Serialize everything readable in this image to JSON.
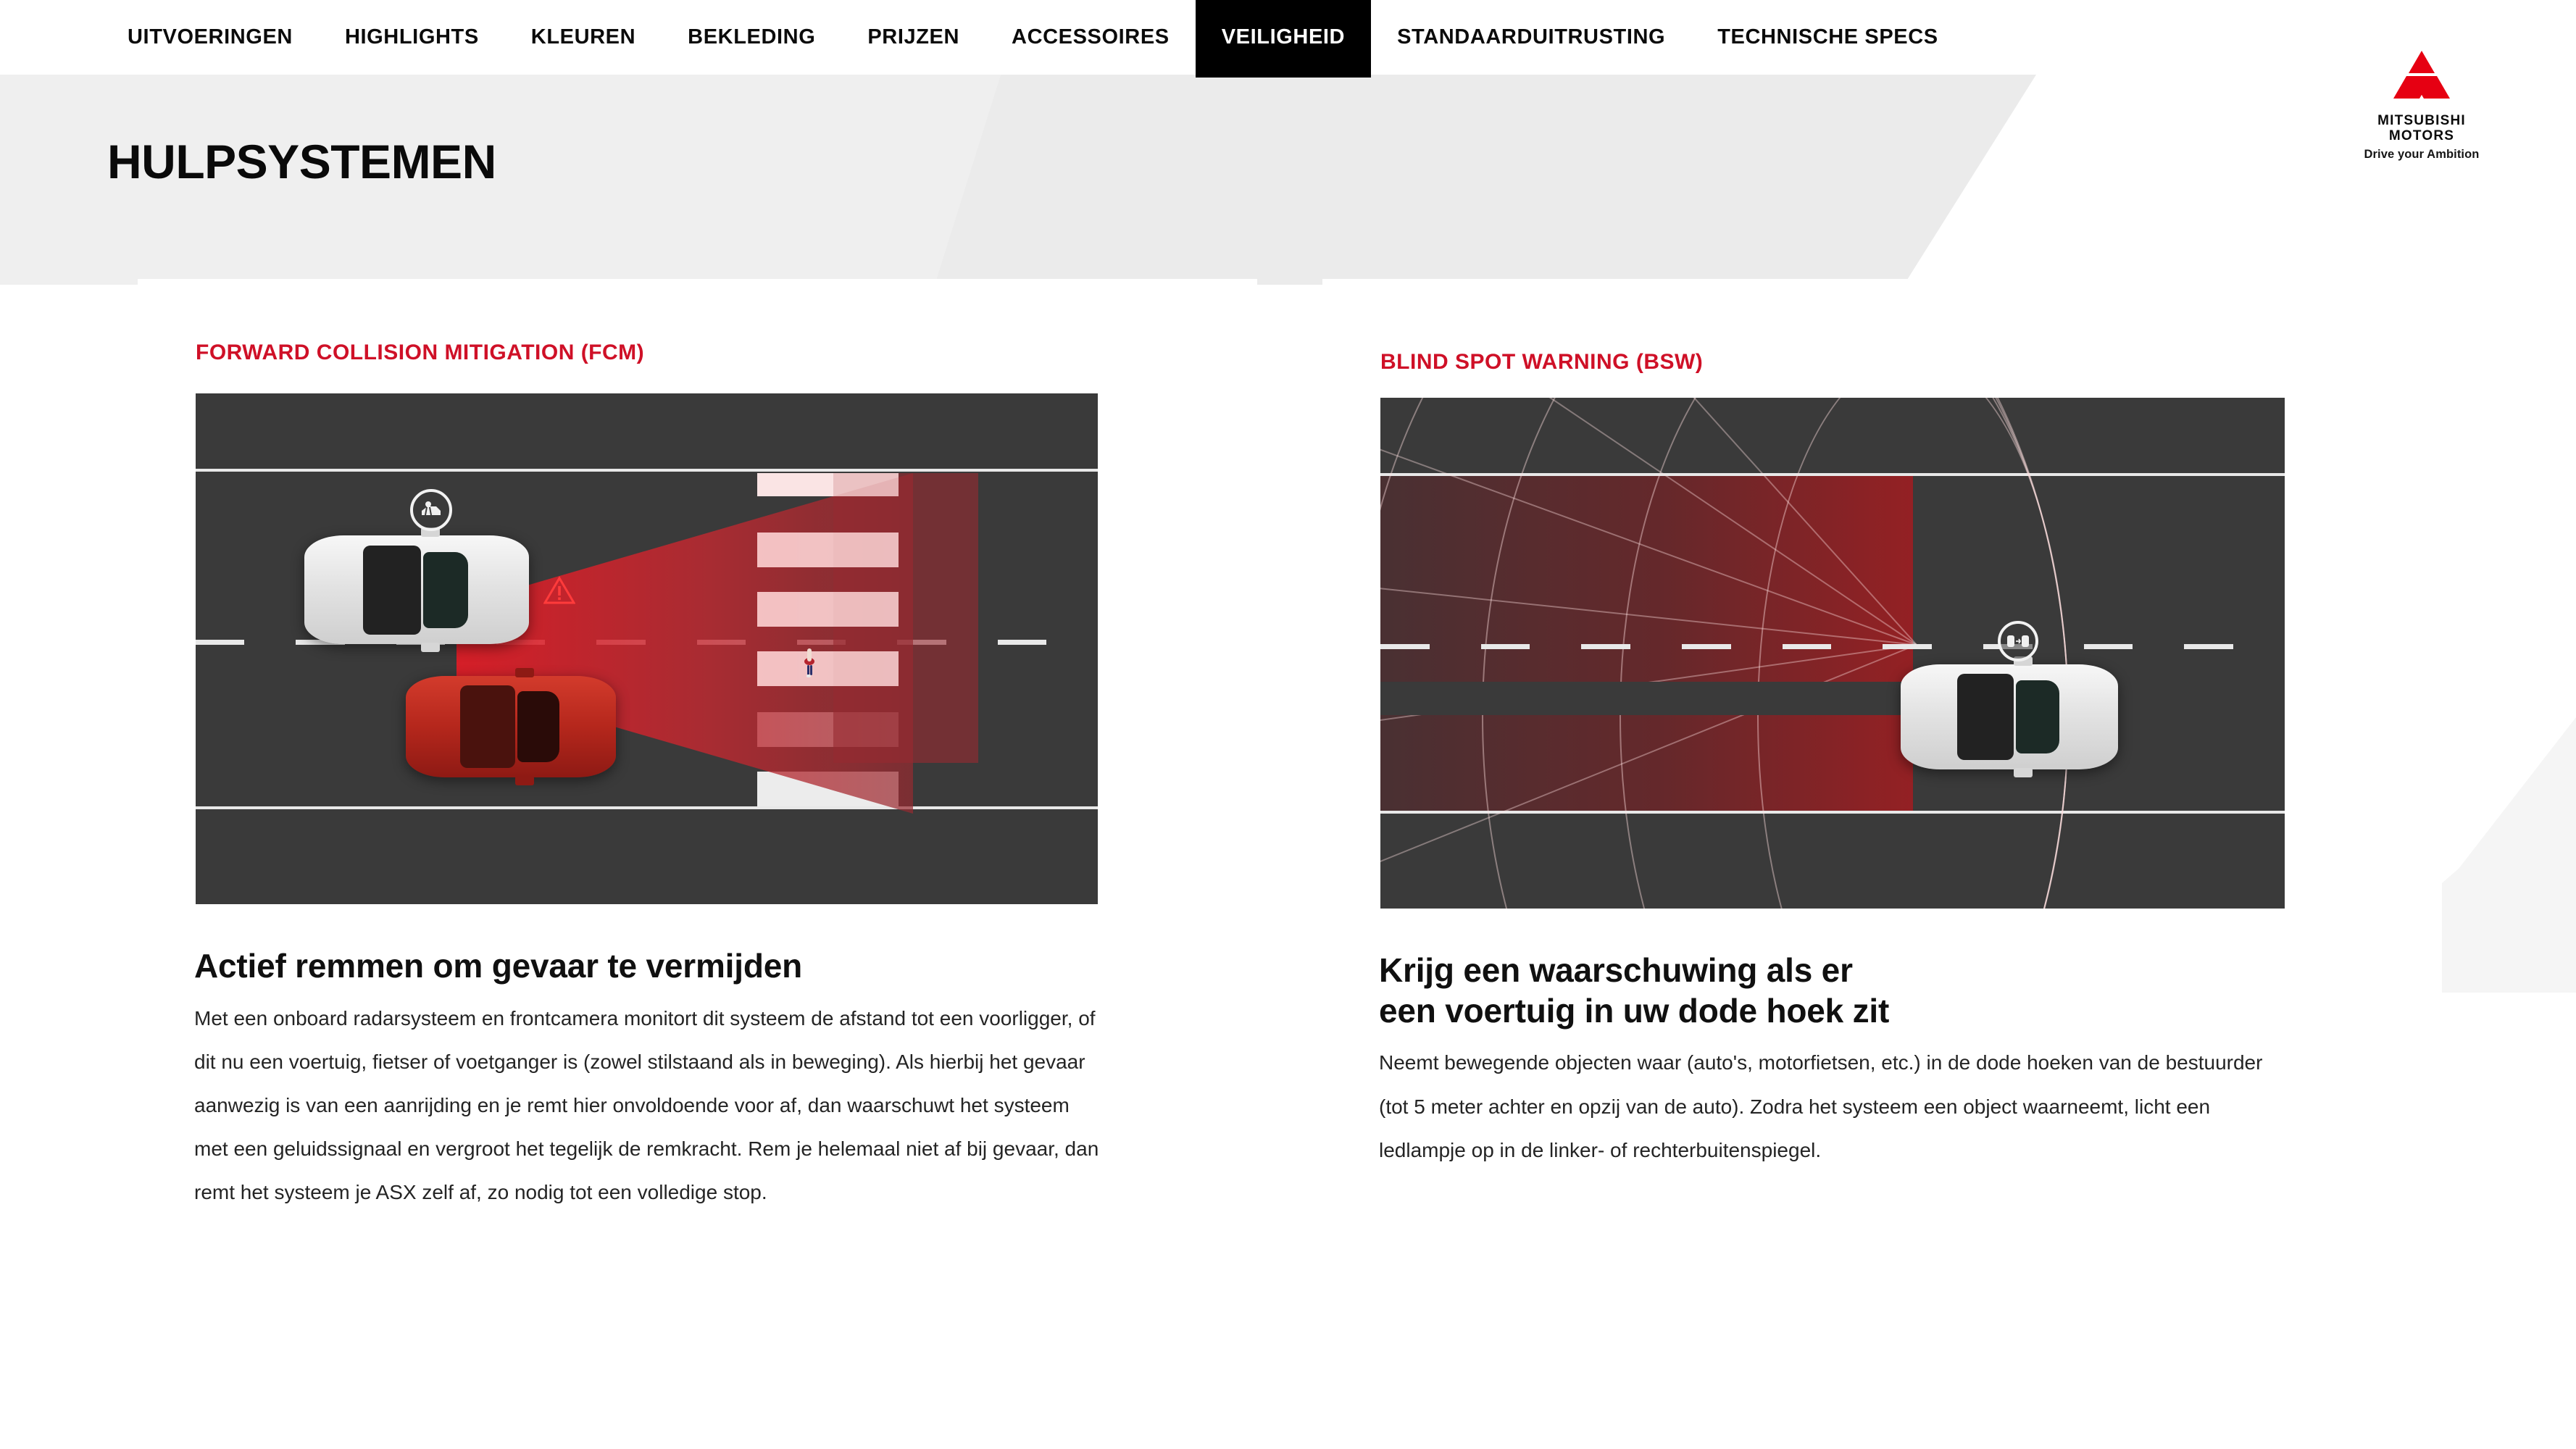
{
  "nav": {
    "items": [
      {
        "label": "UITVOERINGEN",
        "active": false
      },
      {
        "label": "HIGHLIGHTS",
        "active": false
      },
      {
        "label": "KLEUREN",
        "active": false
      },
      {
        "label": "BEKLEDING",
        "active": false
      },
      {
        "label": "PRIJZEN",
        "active": false
      },
      {
        "label": "ACCESSOIRES",
        "active": false
      },
      {
        "label": "VEILIGHEID",
        "active": true
      },
      {
        "label": "STANDAARDUITRUSTING",
        "active": false
      },
      {
        "label": "TECHNISCHE SPECS",
        "active": false
      }
    ]
  },
  "brand": {
    "name_line1": "MITSUBISHI",
    "name_line2": "MOTORS",
    "tagline": "Drive your Ambition",
    "logo_color": "#E60012"
  },
  "page": {
    "title": "HULPSYSTEMEN",
    "accent_color": "#CF1027",
    "background_color": "#FFFFFF"
  },
  "cards": [
    {
      "kicker": "FORWARD COLLISION MITIGATION (FCM)",
      "heading": "Actief remmen om gevaar te vermijden",
      "body": "Met een onboard radarsysteem en frontcamera monitort dit systeem de afstand tot een voorligger, of dit nu een voertuig, fietser of voetganger is (zowel stilstaand als in beweging). Als hierbij het gevaar aanwezig is van een aanrijding en je remt hier onvoldoende voor af, dan waarschuwt het systeem met een geluidssignaal en vergroot het tegelijk de remkracht. Rem je helemaal niet af bij gevaar, dan remt het systeem je ASX zelf af, zo nodig tot een volledige stop.",
      "illustration": {
        "name": "fcm-road-diagram",
        "road_color": "#3A3A3A",
        "radar_color": "#E21C26",
        "ego_car_color": "#F2F2F2",
        "other_car_color": "#C4281C",
        "badge_icon": "pedestrian-detection-icon",
        "warning_icon": "warning-triangle-icon"
      }
    },
    {
      "kicker": "BLIND SPOT WARNING (BSW)",
      "heading_line1": "Krijg een waarschuwing als er",
      "heading_line2": "een voertuig in uw dode hoek zit",
      "body": "Neemt bewegende objecten waar (auto's, motorfietsen, etc.) in de dode hoeken van de bestuurder (tot 5 meter achter en opzij van de auto). Zodra het systeem een object waarneemt, licht een ledlampje op in de linker- of rechterbuitenspiegel.",
      "illustration": {
        "name": "bsw-road-diagram",
        "road_color": "#3A3A3A",
        "zone_color": "#AA1A1E",
        "ego_car_color": "#F2F2F2",
        "badge_icon": "blind-spot-warning-icon"
      }
    }
  ]
}
